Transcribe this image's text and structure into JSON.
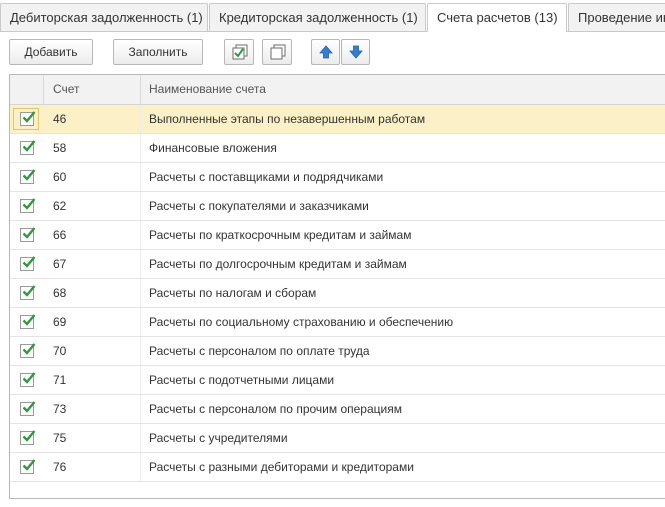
{
  "tabs": [
    {
      "label": "Дебиторская задолженность (1)",
      "active": false
    },
    {
      "label": "Кредиторская задолженность (1)",
      "active": false
    },
    {
      "label": "Счета расчетов (13)",
      "active": true
    },
    {
      "label": "Проведение инвентаризации",
      "active": false
    }
  ],
  "toolbar": {
    "add_label": "Добавить",
    "fill_label": "Заполнить",
    "check_all_icon": "check-all-icon",
    "uncheck_all_icon": "uncheck-all-icon",
    "move_up_icon": "arrow-up-icon",
    "move_down_icon": "arrow-down-icon"
  },
  "table": {
    "columns": [
      "Счет",
      "Наименование счета"
    ],
    "rows": [
      {
        "checked": true,
        "code": "46",
        "name": "Выполненные этапы по незавершенным работам",
        "selected": true
      },
      {
        "checked": true,
        "code": "58",
        "name": "Финансовые вложения",
        "selected": false
      },
      {
        "checked": true,
        "code": "60",
        "name": "Расчеты с поставщиками и подрядчиками",
        "selected": false
      },
      {
        "checked": true,
        "code": "62",
        "name": "Расчеты с покупателями и заказчиками",
        "selected": false
      },
      {
        "checked": true,
        "code": "66",
        "name": "Расчеты по краткосрочным кредитам и займам",
        "selected": false
      },
      {
        "checked": true,
        "code": "67",
        "name": "Расчеты по долгосрочным кредитам и займам",
        "selected": false
      },
      {
        "checked": true,
        "code": "68",
        "name": "Расчеты по налогам и сборам",
        "selected": false
      },
      {
        "checked": true,
        "code": "69",
        "name": "Расчеты по социальному страхованию и обеспечению",
        "selected": false
      },
      {
        "checked": true,
        "code": "70",
        "name": "Расчеты с персоналом по оплате труда",
        "selected": false
      },
      {
        "checked": true,
        "code": "71",
        "name": "Расчеты с подотчетными лицами",
        "selected": false
      },
      {
        "checked": true,
        "code": "73",
        "name": "Расчеты с персоналом по прочим операциям",
        "selected": false
      },
      {
        "checked": true,
        "code": "75",
        "name": "Расчеты с учредителями",
        "selected": false
      },
      {
        "checked": true,
        "code": "76",
        "name": "Расчеты с разными дебиторами и кредиторами",
        "selected": false
      }
    ]
  },
  "colors": {
    "selected_row": "#fbf0c6",
    "checkmark": "#2e9a3a",
    "arrow_blue": "#2f7fd6"
  }
}
